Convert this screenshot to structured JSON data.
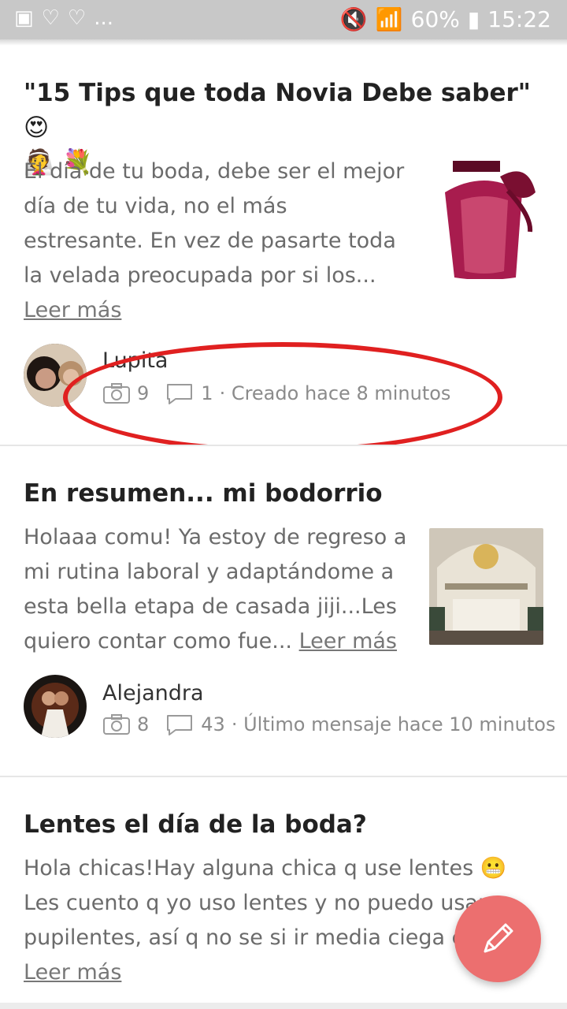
{
  "status": {
    "battery": "60%",
    "time": "15:22",
    "dots": "..."
  },
  "posts": [
    {
      "title_line1": "\"15 Tips que toda Novia Debe saber\"",
      "excerpt": "El día de tu boda, debe ser el mejor día de tu vida, no el más estresante. En vez de pasarte toda la velada preocupada por si los...",
      "more": "Leer más",
      "author": "Lupita",
      "photos": "9",
      "comments": "1",
      "time_text": "· Creado hace 8 minutos"
    },
    {
      "title": "En resumen... mi bodorrio",
      "excerpt": "Holaaa comu! Ya estoy de regreso a mi rutina laboral y adaptándome a esta bella etapa de casada jiji...Les quiero contar como fue...",
      "more": "Leer más",
      "author": "Alejandra",
      "photos": "8",
      "comments": "43",
      "time_text": "· Último mensaje hace 10 minutos"
    },
    {
      "title": "Lentes el día de la boda?",
      "excerpt": "Hola chicas!Hay alguna chica q use lentes 😬 Les cuento q yo uso lentes y no puedo usar pupilentes, así q no se si ir media ciega el día...",
      "more": "Leer más"
    }
  ],
  "icons": {
    "camera": "camera-icon",
    "comment": "comment-icon",
    "fab": "pencil-icon"
  },
  "colors": {
    "highlight_ring": "#e02020",
    "fab": "#ec6f6f"
  }
}
